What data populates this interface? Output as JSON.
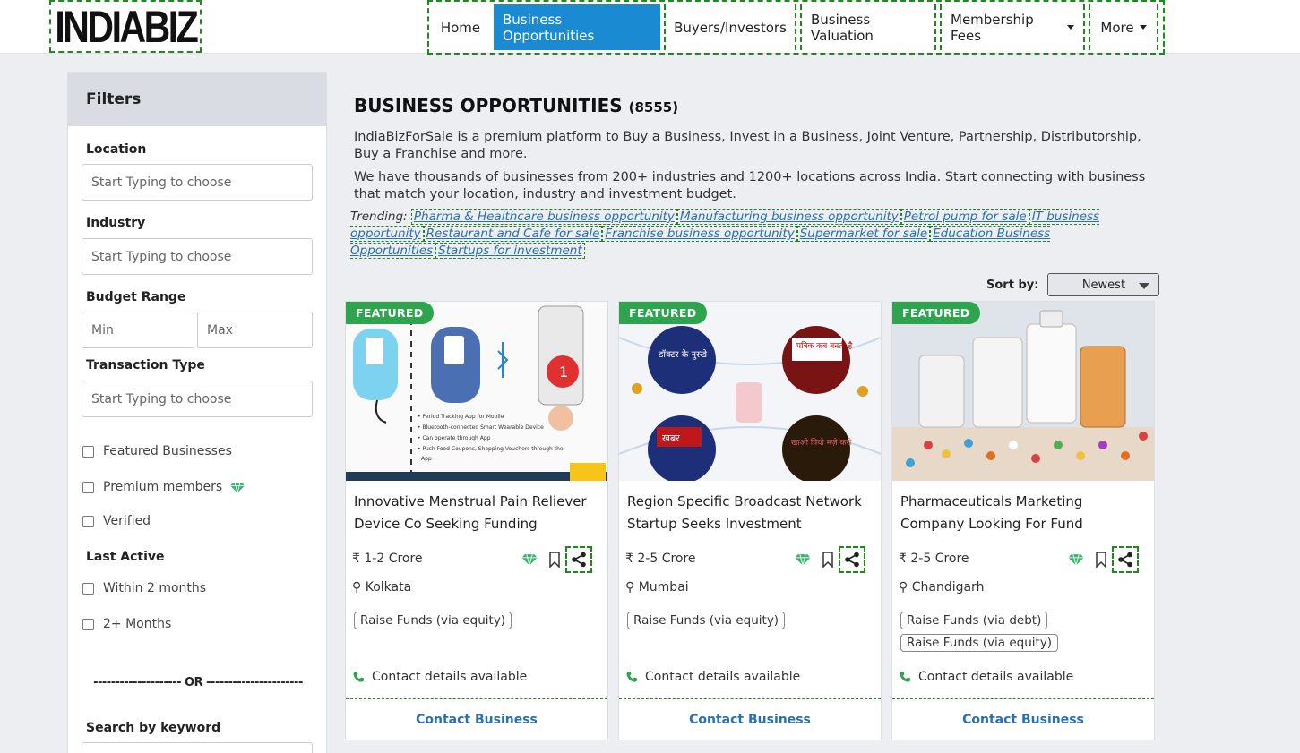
{
  "header": {
    "logo": "INDIABIZ",
    "nav": [
      {
        "label": "Home"
      },
      {
        "label": "Business Opportunities"
      },
      {
        "label": "Buyers/Investors"
      },
      {
        "label": "Business Valuation"
      },
      {
        "label": "Membership Fees"
      },
      {
        "label": "More"
      }
    ]
  },
  "filters": {
    "title": "Filters",
    "location_label": "Location",
    "location_placeholder": "Start Typing to choose",
    "industry_label": "Industry",
    "industry_placeholder": "Start Typing to choose",
    "budget_label": "Budget Range",
    "budget_min": "Min",
    "budget_max": "Max",
    "transaction_label": "Transaction Type",
    "transaction_placeholder": "Start Typing to choose",
    "checks": [
      "Featured Businesses",
      "Premium members",
      "Verified"
    ],
    "last_active_label": "Last Active",
    "last_active": [
      "Within 2 months",
      "2+ Months"
    ],
    "or_text": "-------------------- OR ----------------------",
    "keyword_label": "Search by keyword"
  },
  "main": {
    "title": "BUSINESS OPPORTUNITIES",
    "count": "(8555)",
    "desc1": "IndiaBizForSale is a premium platform to Buy a Business, Invest in a Business, Joint Venture, Partnership, Distributorship, Buy a Franchise and more.",
    "desc2": "We have thousands of businesses from 200+ industries and 1200+ locations across India. Start connecting with business that match your location, industry and investment budget.",
    "trending_label": "Trending:",
    "trending": [
      "Pharma & Healthcare business opportunity",
      "Manufacturing business opportunity",
      "Petrol pump for sale",
      "IT business opportunity",
      "Restaurant and Cafe for sale",
      "Franchise business opportunity",
      "Supermarket for sale",
      "Education Business Opportunities",
      "Startups for investment"
    ],
    "sort_label": "Sort by:",
    "sort_value": "Newest"
  },
  "cards": [
    {
      "badge": "FEATURED",
      "title": "Innovative Menstrual Pain Reliever Device Co Seeking Funding",
      "price": "1-2 Crore",
      "location": "Kolkata",
      "tags": [
        "Raise Funds (via equity)"
      ],
      "contact_avail": "Contact details available",
      "contact_btn": "Contact Business",
      "currency": "₹"
    },
    {
      "badge": "FEATURED",
      "title": "Region Specific Broadcast Network Startup Seeks Investment",
      "price": "2-5 Crore",
      "location": "Mumbai",
      "tags": [
        "Raise Funds (via equity)"
      ],
      "contact_avail": "Contact details available",
      "contact_btn": "Contact Business",
      "currency": "₹",
      "img_text": [
        "डॉक्टर के नुस्खे",
        "पत्रिक कब बनती है",
        "खबर",
        "खाओ पियो मज़े करो"
      ]
    },
    {
      "badge": "FEATURED",
      "title": "Pharmaceuticals Marketing Company Looking For Fund",
      "price": "2-5 Crore",
      "location": "Chandigarh",
      "tags": [
        "Raise Funds (via debt)",
        "Raise Funds (via equity)"
      ],
      "contact_avail": "Contact details available",
      "contact_btn": "Contact Business",
      "currency": "₹"
    }
  ],
  "colors": {
    "accent": "#1a8bd3",
    "featured": "#2ea44f",
    "link": "#2a6fb0"
  }
}
